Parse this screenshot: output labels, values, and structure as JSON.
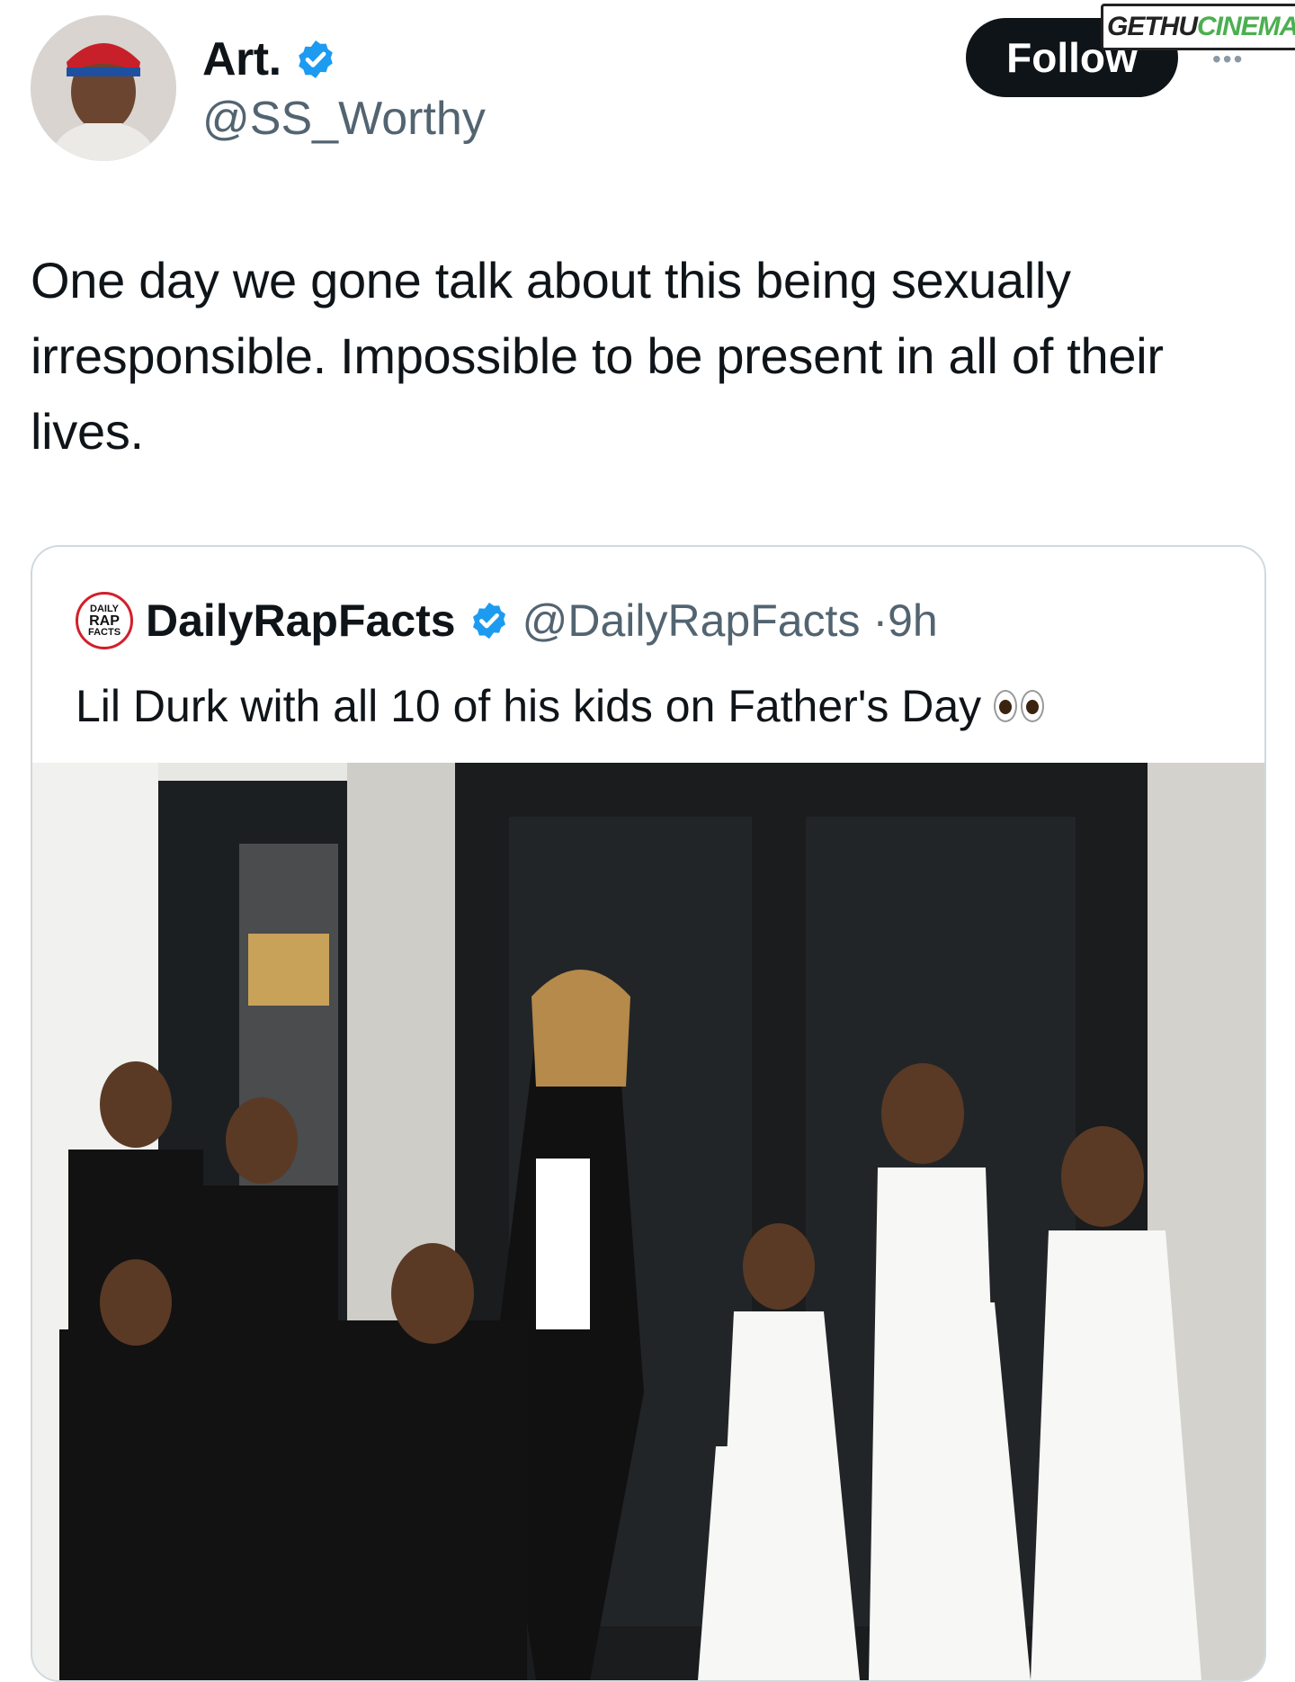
{
  "author": {
    "display_name": "Art.",
    "handle": "@SS_Worthy",
    "verified": true
  },
  "actions": {
    "follow_label": "Follow",
    "more_label": "•••"
  },
  "watermark": {
    "part_a": "GETHU",
    "part_b": "CINEMA"
  },
  "tweet": {
    "text": "One day we gone talk about this being sexually irresponsible. Impossible to be present in all of their lives."
  },
  "quoted_tweet": {
    "display_name": "DailyRapFacts",
    "handle": "@DailyRapFacts",
    "time": "·9h",
    "logo_lines": [
      "DAILY",
      "RAP",
      "FACTS"
    ],
    "text": "Lil Durk with all 10 of his kids on Father's Day",
    "emoji": "eyes-emoji",
    "image": "photo-family-group"
  },
  "colors": {
    "verified_blue": "#1d9bf0",
    "follow_bg": "#0f1419",
    "muted_text": "#536471",
    "card_border": "#cfd9de"
  }
}
